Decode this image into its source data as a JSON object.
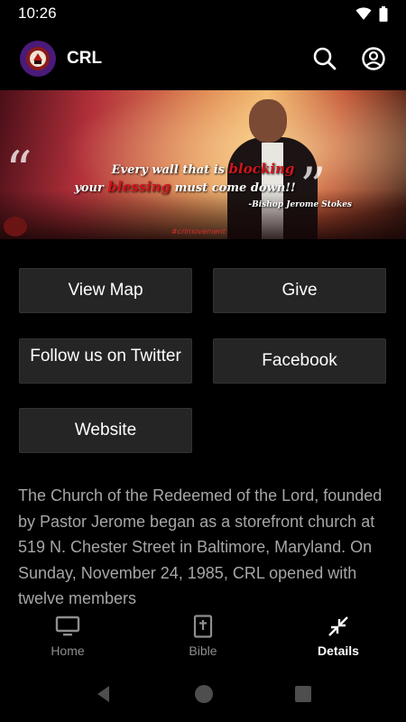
{
  "status_bar": {
    "time": "10:26"
  },
  "app_bar": {
    "title": "CRL",
    "logo_icon": "church-logo-icon",
    "search_icon": "search-icon",
    "account_icon": "account-circle-icon"
  },
  "banner": {
    "quote_line1_pre": "Every wall that is ",
    "quote_line1_hl": "blocking",
    "quote_line2_pre": "your ",
    "quote_line2_hl": "blessing",
    "quote_line2_post": " must come down!!",
    "author": "-Bishop Jerome Stokes",
    "hashtag": "#crlmovement"
  },
  "buttons": {
    "view_map": "View Map",
    "give": "Give",
    "twitter": "Follow us on Twitter",
    "facebook": "Facebook",
    "website": "Website"
  },
  "description": "The Church of the Redeemed of the Lord, founded by Pastor Jerome began as a storefront church at 519 N. Chester Street in Baltimore, Maryland. On Sunday, November 24, 1985, CRL opened with twelve members",
  "bottom_nav": {
    "items": [
      {
        "label": "Home",
        "icon": "tv-icon",
        "active": false
      },
      {
        "label": "Bible",
        "icon": "bible-icon",
        "active": false
      },
      {
        "label": "Details",
        "icon": "collapse-arrows-icon",
        "active": true
      }
    ]
  },
  "system_nav": {
    "back": "back-triangle-icon",
    "home": "home-circle-icon",
    "recents": "recents-square-icon"
  },
  "colors": {
    "background": "#000000",
    "button_bg": "#252525",
    "description_text": "#a6a6a6",
    "highlight_red": "#d4141c",
    "logo_purple": "#4a1a78"
  }
}
